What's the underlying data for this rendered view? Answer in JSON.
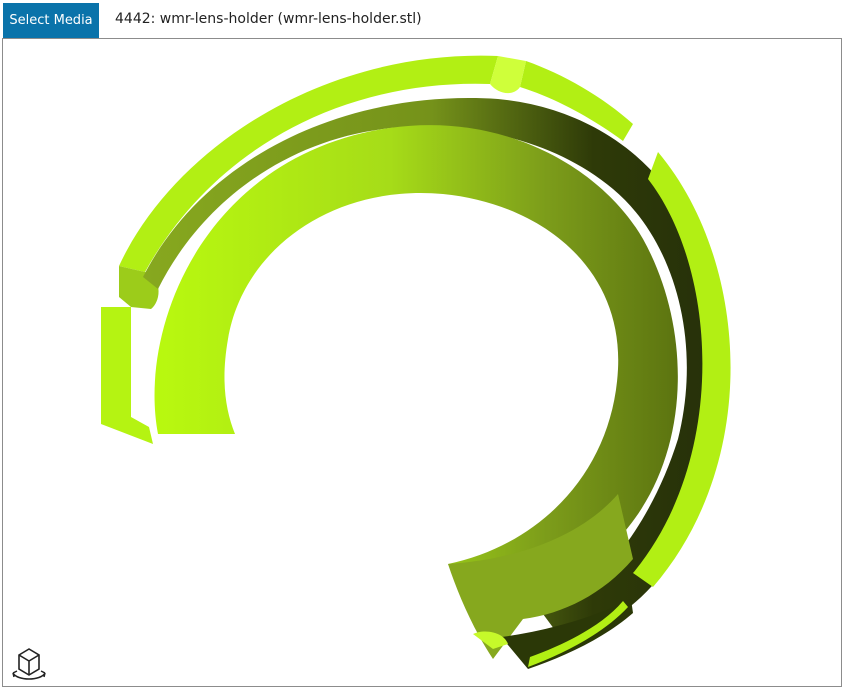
{
  "toolbar": {
    "select_media_label": "Select Media"
  },
  "file": {
    "title": "4442: wmr-lens-holder (wmr-lens-holder.stl)"
  },
  "viewer": {
    "model_colors": {
      "bright": "#b5f312",
      "top_face": "#aeea14",
      "mid": "#86a81e",
      "shade": "#6d8a10",
      "dark": "#2b3807"
    }
  },
  "icons": {
    "view_reset": "view-cube-rotate-icon"
  }
}
